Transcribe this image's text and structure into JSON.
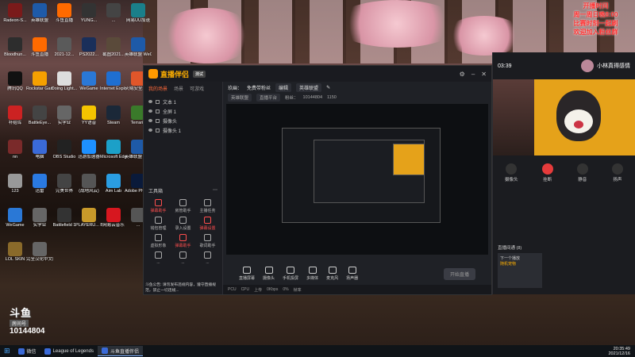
{
  "desktop": {
    "icons": [
      {
        "label": "Radeon-S...",
        "color": "#7a1a1a"
      },
      {
        "label": "英雄联盟",
        "color": "#1e5aa8"
      },
      {
        "label": "斗鱼直播",
        "color": "#ff6a00"
      },
      {
        "label": "YUNG...",
        "color": "#333"
      },
      {
        "label": "...",
        "color": "#444"
      },
      {
        "label": "网易UU加速",
        "color": "#1a7f8a"
      },
      {
        "label": "Bloodhun...",
        "color": "#2d2d2d"
      },
      {
        "label": "斗鱼直播",
        "color": "#ff6a00"
      },
      {
        "label": "2021-12...",
        "color": "#5a5a5a"
      },
      {
        "label": "PS2022...",
        "color": "#1a2f5a"
      },
      {
        "label": "截图2021...",
        "color": "#5a4a3a"
      },
      {
        "label": "英雄联盟 WeGame版",
        "color": "#1e5aa8"
      },
      {
        "label": "腾讯QQ",
        "color": "#111"
      },
      {
        "label": "Rockstar Games...",
        "color": "#f5a000"
      },
      {
        "label": "Doing Light...",
        "color": "#ddd"
      },
      {
        "label": "WeGame",
        "color": "#2a78d6"
      },
      {
        "label": "Internet Explorer",
        "color": "#1f6fd1"
      },
      {
        "label": "火绒安全软件",
        "color": "#e0562a"
      },
      {
        "label": "补给库",
        "color": "#c22"
      },
      {
        "label": "BattleEye...",
        "color": "#444"
      },
      {
        "label": "实学业",
        "color": "#666"
      },
      {
        "label": "YY语音",
        "color": "#f5c400"
      },
      {
        "label": "Steam",
        "color": "#1b2838"
      },
      {
        "label": "Terraria",
        "color": "#3a7a2a"
      },
      {
        "label": "nn",
        "color": "#7a2a2a"
      },
      {
        "label": "电脑",
        "color": "#3a6ad8"
      },
      {
        "label": "OBS Studio",
        "color": "#222"
      },
      {
        "label": "迅游加速器",
        "color": "#1e90ff"
      },
      {
        "label": "Microsoft Edge",
        "color": "#1ca0c8"
      },
      {
        "label": "英雄联盟 WeGame版",
        "color": "#1e5aa8"
      },
      {
        "label": "123",
        "color": "#999"
      },
      {
        "label": "迅雷",
        "color": "#2a7ae2"
      },
      {
        "label": "完美世界",
        "color": "#444"
      },
      {
        "label": "(战地风云)",
        "color": "#555"
      },
      {
        "label": "Aim Lab",
        "color": "#2a9de2"
      },
      {
        "label": "Adobe Photosho...",
        "color": "#0a1a3a"
      },
      {
        "label": "WeGame",
        "color": "#2a78d6"
      },
      {
        "label": "实学业",
        "color": "#666"
      },
      {
        "label": "Battlefield 1",
        "color": "#333"
      },
      {
        "label": "PLAYERU... BATTLEGR...",
        "color": "#c99a2a"
      },
      {
        "label": "网易云音乐",
        "color": "#d7171f"
      },
      {
        "label": "...",
        "color": "#555"
      },
      {
        "label": "LOL SKIN",
        "color": "#8a6a2a"
      },
      {
        "label": "完全汉化中文版",
        "color": "#666"
      }
    ]
  },
  "app": {
    "brand": "直播伴侣",
    "version": "测试",
    "left_tabs": [
      "我的场景",
      "场景",
      "可游戏"
    ],
    "scenes": [
      "文本 1",
      "全屏 1",
      "摄像头",
      "摄像头 1"
    ],
    "tools_title": "工具箱",
    "tools": [
      {
        "label": "弹幕助手",
        "red": true
      },
      {
        "label": "房管助手",
        "red": false
      },
      {
        "label": "主播任务",
        "red": false
      },
      {
        "label": "钱包管理",
        "red": false
      },
      {
        "label": "录入设置",
        "red": false
      },
      {
        "label": "弹幕设置",
        "red": true
      },
      {
        "label": "虚拟形象",
        "red": false
      },
      {
        "label": "弹幕助手",
        "red": true
      },
      {
        "label": "歌词助手",
        "red": false
      },
      {
        "label": "...",
        "red": false
      },
      {
        "label": "...",
        "red": false
      },
      {
        "label": "...",
        "red": false
      }
    ],
    "room_title": "玖幽：",
    "room_name": "免费带粉丝",
    "edit": "编辑",
    "category": "英雄联盟",
    "info": [
      "英雄联盟",
      "直播平台",
      "粉丝：",
      "10144804",
      "1150"
    ],
    "bottom_buttons": [
      "直播屏幕",
      "摄像头",
      "手机投屏",
      "多媒体",
      "麦克风",
      "扬声器"
    ],
    "go_live": "开始直播",
    "status": [
      "PCU",
      "CPU",
      "上传",
      "0Kbps",
      "0%",
      "帧率"
    ],
    "notice": "斗鱼公告: 请勿发布违规内容，遵守直播规范，禁止一切违规..."
  },
  "call": {
    "name": "小林真得感情",
    "timer": "03:39",
    "buttons": [
      {
        "label": "摄像头",
        "hang": false
      },
      {
        "label": "挂断",
        "hang": true
      },
      {
        "label": "静音",
        "hang": false
      },
      {
        "label": "扬声",
        "hang": false
      }
    ],
    "sub_title": "直播间通 (8)",
    "sub_caption": "下一个播放",
    "sub_name": "随机宠物"
  },
  "overlay": {
    "lines": [
      "开播时间",
      "周一周日晚8:00",
      "比赛时刻一起刷",
      "欢迎加入粉丝群"
    ]
  },
  "watermark": {
    "logo": "斗鱼",
    "tag": "房间号",
    "room_id": "10144804"
  },
  "taskbar": {
    "items": [
      {
        "label": "微信",
        "active": false
      },
      {
        "label": "League of Legends",
        "active": false
      },
      {
        "label": "斗鱼直播伴侣",
        "active": true
      }
    ],
    "time": "20:35:49",
    "date": "2021/12/16"
  }
}
